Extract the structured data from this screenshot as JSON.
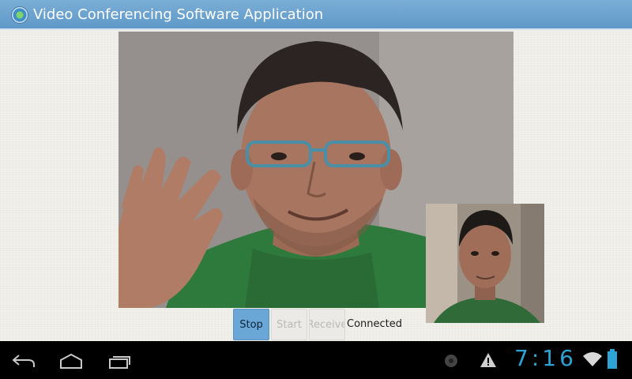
{
  "window": {
    "title": "Video Conferencing Software Application"
  },
  "main_video": {
    "description_icon": "remote-video-feed"
  },
  "self_video": {
    "description_icon": "local-camera-preview"
  },
  "controls": {
    "stop_label": "Stop",
    "start_label": "Start",
    "receive_label": "Receive",
    "status_text": "Connected"
  },
  "system_bar": {
    "clock": "7:16",
    "icons": [
      "back-icon",
      "home-icon",
      "recent-apps-icon",
      "notification-icon",
      "warning-icon",
      "wifi-icon",
      "battery-icon"
    ]
  },
  "colors": {
    "title_bar": "#6ba3d0",
    "stop_button": "#6aa7d6",
    "clock": "#2ea3d6",
    "background": "#f2f0ea"
  }
}
